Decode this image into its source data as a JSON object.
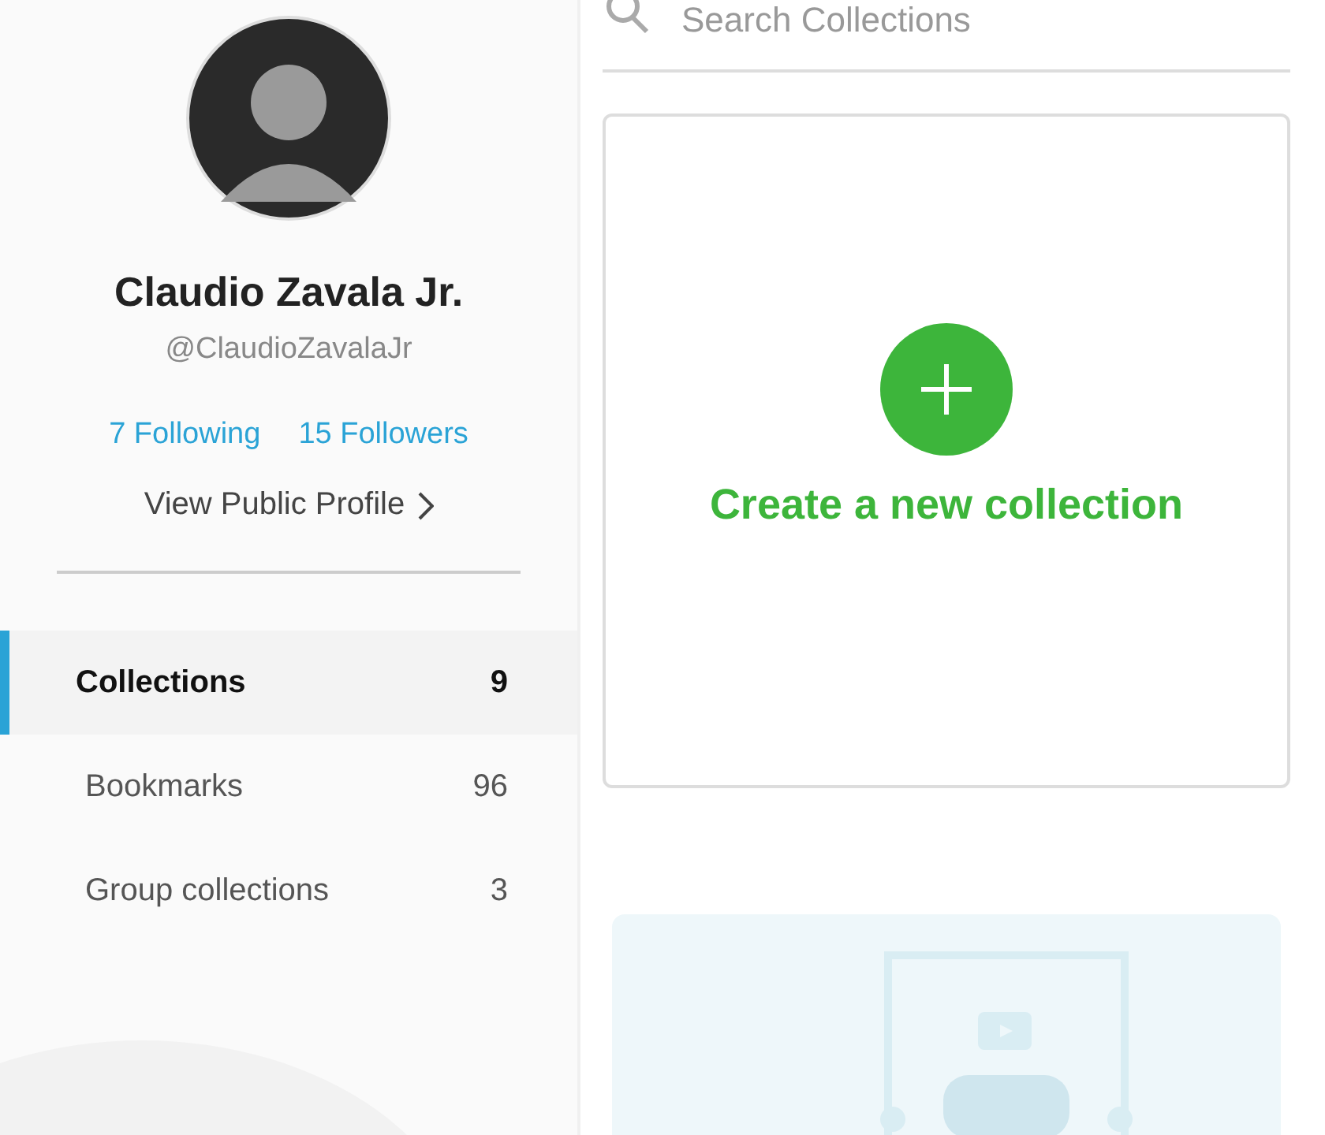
{
  "profile": {
    "name": "Claudio Zavala Jr.",
    "handle": "@ClaudioZavalaJr",
    "following": "7 Following",
    "followers": "15 Followers",
    "view_profile": "View Public Profile"
  },
  "nav": [
    {
      "label": "Collections",
      "count": "9",
      "selected": true
    },
    {
      "label": "Bookmarks",
      "count": "96",
      "selected": false
    },
    {
      "label": "Group collections",
      "count": "3",
      "selected": false
    }
  ],
  "search": {
    "placeholder": "Search Collections"
  },
  "create_card": {
    "label": "Create a new collection"
  }
}
